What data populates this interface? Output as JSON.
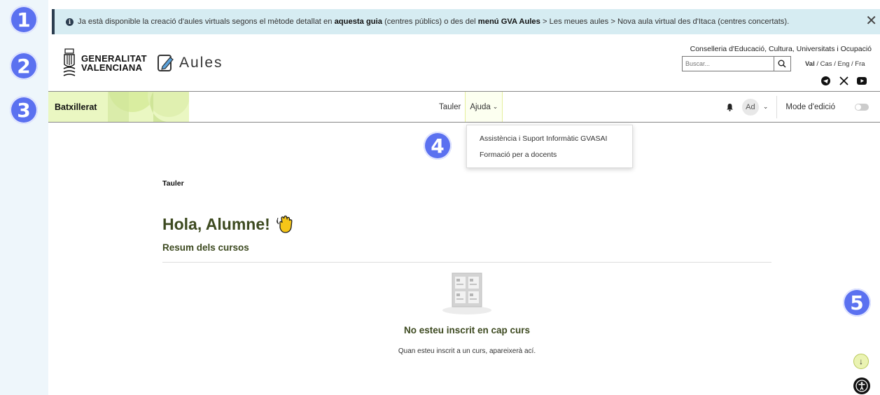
{
  "badges": [
    "1",
    "2",
    "3",
    "4",
    "5"
  ],
  "alert": {
    "part1": "Ja està disponible la creació d'aules virtuals segons el mètode detallat en ",
    "link1": "aquesta guia",
    "part2": " (centres públics) o des del ",
    "link2": "menú GVA Aules",
    "part3": " > Les meues aules > Nova aula virtual des d'Itaca (centres concertats).",
    "close": "✕"
  },
  "header": {
    "gva_line1": "GENERALITAT",
    "gva_line2": "VALENCIANA",
    "aules": "Aules",
    "conselleria": "Conselleria d'Educació, Cultura, Universitats i Ocupació",
    "search_placeholder": "Buscar...",
    "lang_active": "Val",
    "lang_others": " / Cas / Eng / Fra"
  },
  "nav": {
    "brand": "Batxillerat",
    "links": [
      "Tauler",
      "Ajuda"
    ],
    "avatar": "Ad",
    "edit_mode": "Mode d'edició"
  },
  "dropdown": {
    "items": [
      "Assistència i Suport Informàtic GVASAI",
      "Formació per a docents"
    ]
  },
  "main": {
    "breadcrumb": "Tauler",
    "greeting": "Hola, Alumne!",
    "courses_title": "Resum dels cursos",
    "empty_title": "No esteu inscrit en cap curs",
    "empty_desc": "Quan esteu inscrit a un curs, apareixerà ací."
  },
  "colors": {
    "badge": "#5b71f0",
    "alert_bg": "#d6ecf2",
    "brand_bg": "#eaf7c2",
    "heading": "#3d4a20"
  }
}
